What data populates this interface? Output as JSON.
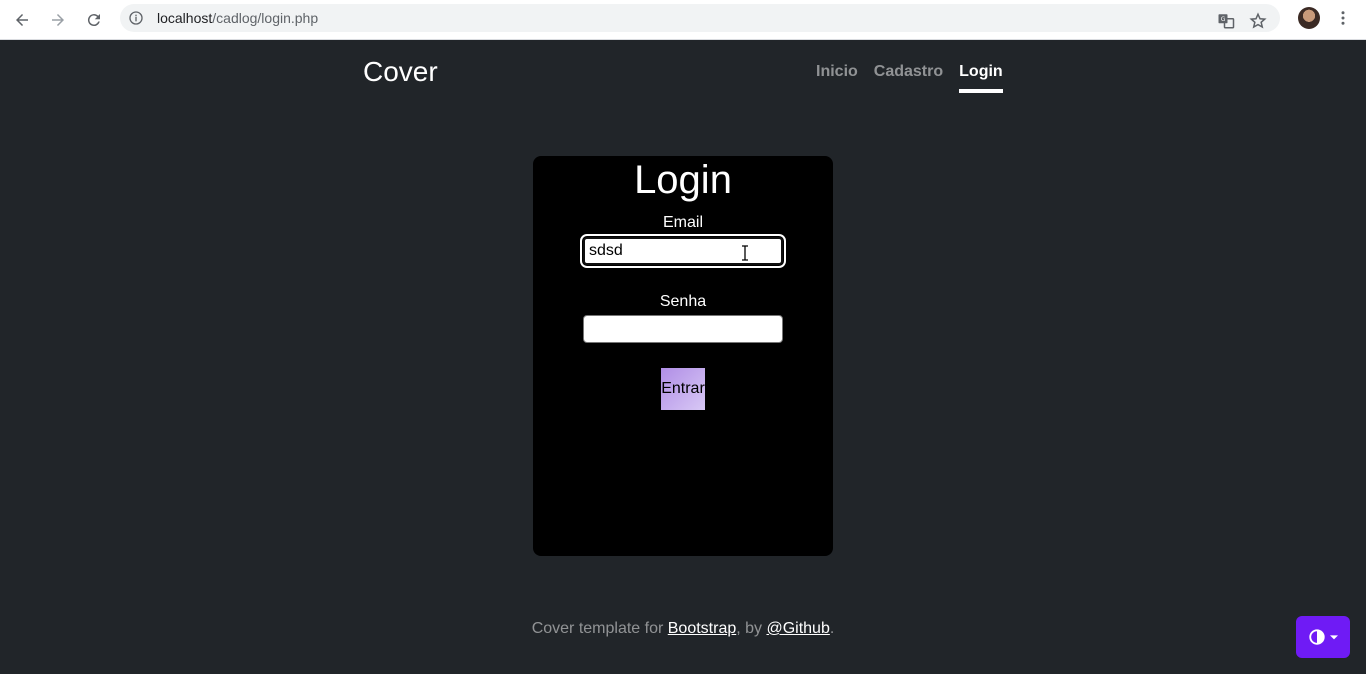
{
  "browser": {
    "url_host": "localhost",
    "url_path": "/cadlog/login.php"
  },
  "header": {
    "brand": "Cover",
    "nav": [
      {
        "label": "Inicio",
        "active": false
      },
      {
        "label": "Cadastro",
        "active": false
      },
      {
        "label": "Login",
        "active": true
      }
    ]
  },
  "login": {
    "title": "Login",
    "email_label": "Email",
    "email_value": "sdsd",
    "senha_label": "Senha",
    "senha_value": "",
    "submit_label": "Entrar"
  },
  "footer": {
    "prefix": "Cover template for ",
    "link1": "Bootstrap",
    "middle": ", by ",
    "link2": "@Github",
    "suffix": "."
  },
  "theme_toggle": {
    "icon": "contrast-icon",
    "accent": "#6f1bf5"
  }
}
